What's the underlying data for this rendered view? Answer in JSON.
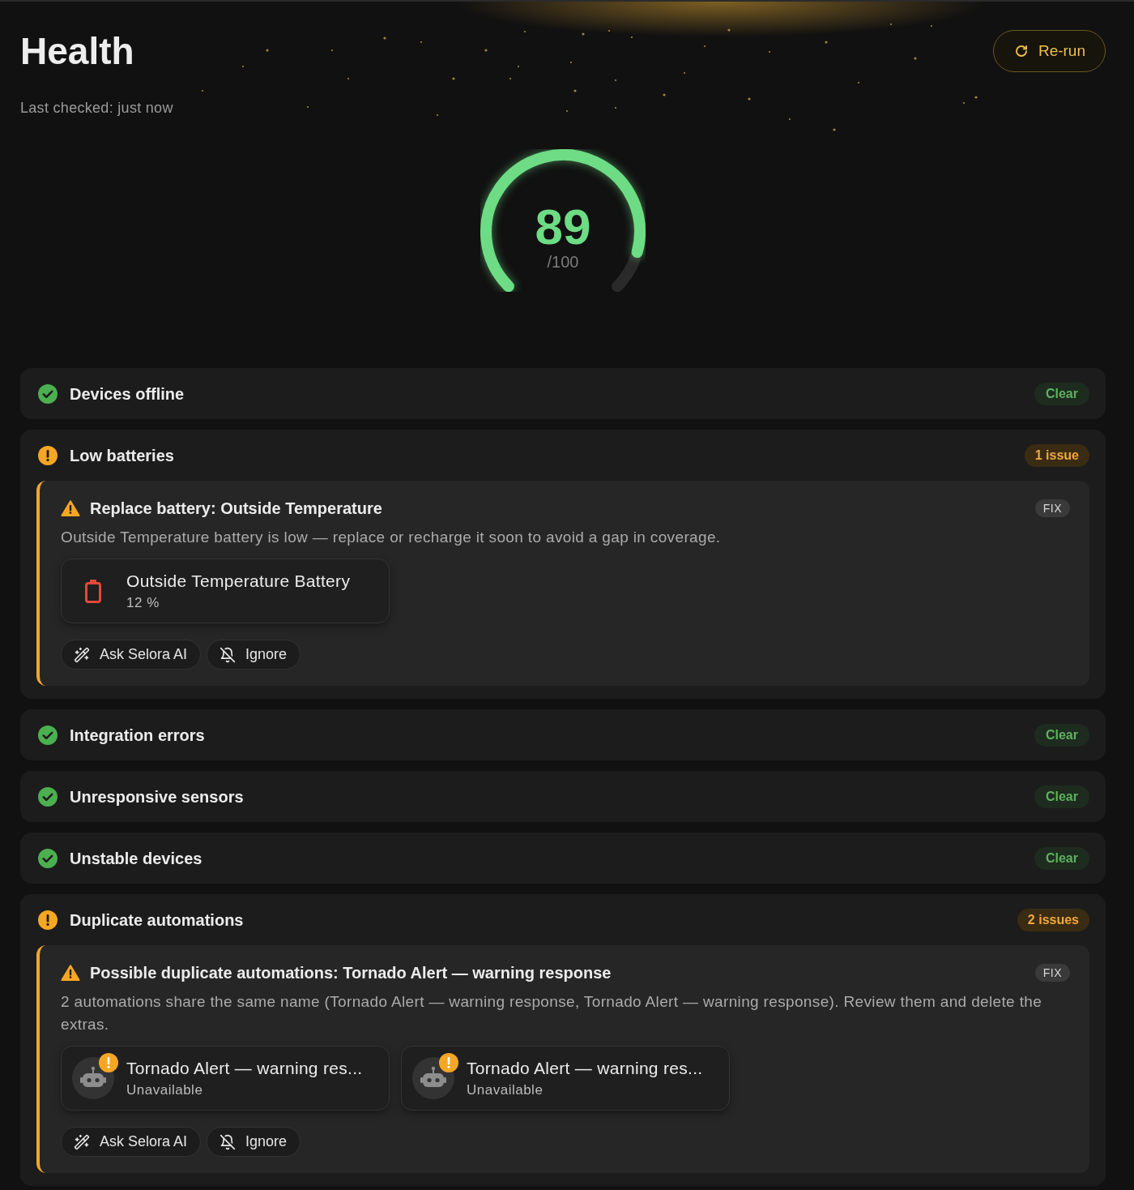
{
  "page": {
    "title": "Health",
    "last_checked": "Last checked: just now",
    "rerun_button": "Re-run"
  },
  "score": {
    "value": "89",
    "max": "/100",
    "level": 0.89
  },
  "sections": [
    {
      "title": "Devices offline",
      "kind": "clear",
      "badge": "Clear"
    },
    {
      "title": "Low batteries",
      "kind": "issues",
      "badge": "1 issue",
      "issues": [
        {
          "title": "Replace battery: Outside Temperature",
          "tag": "FIX",
          "description": "Outside Temperature battery is low — replace or recharge it soon to avoid a gap in coverage.",
          "entities": [
            {
              "kind": "battery",
              "name": "Outside Temperature Battery",
              "state": "12 %",
              "alert": false
            }
          ],
          "actions": [
            {
              "kind": "ask_ai",
              "label": "Ask Selora AI"
            },
            {
              "kind": "ignore",
              "label": "Ignore"
            }
          ]
        }
      ]
    },
    {
      "title": "Integration errors",
      "kind": "clear",
      "badge": "Clear"
    },
    {
      "title": "Unresponsive sensors",
      "kind": "clear",
      "badge": "Clear"
    },
    {
      "title": "Unstable devices",
      "kind": "clear",
      "badge": "Clear"
    },
    {
      "title": "Duplicate automations",
      "kind": "issues",
      "badge": "2 issues",
      "issues": [
        {
          "title": "Possible duplicate automations: Tornado Alert — warning response",
          "tag": "FIX",
          "description": "2 automations share the same name (Tornado Alert — warning response, Tornado Alert — warning response). Review them and delete the extras.",
          "entities": [
            {
              "kind": "automation",
              "name": "Tornado Alert — warning res...",
              "state": "Unavailable",
              "alert": true
            },
            {
              "kind": "automation",
              "name": "Tornado Alert — warning res...",
              "state": "Unavailable",
              "alert": true
            }
          ],
          "actions": [
            {
              "kind": "ask_ai",
              "label": "Ask Selora AI"
            },
            {
              "kind": "ignore",
              "label": "Ignore"
            }
          ]
        }
      ]
    }
  ]
}
